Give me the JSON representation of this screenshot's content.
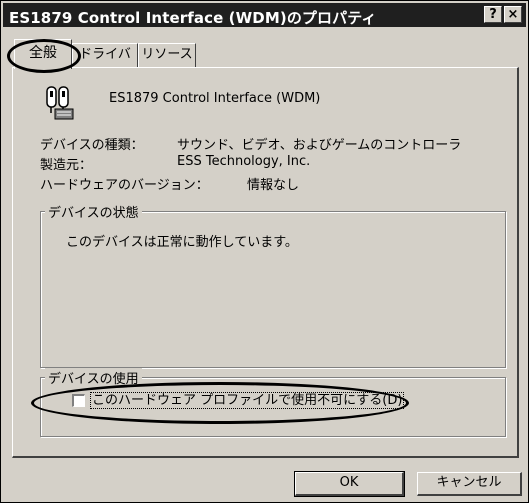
{
  "window": {
    "title": "ES1879 Control Interface (WDM)のプロパティ",
    "help_glyph": "?",
    "close_glyph": "×"
  },
  "tabs": [
    {
      "label": "全般",
      "active": true
    },
    {
      "label": "ドライバ",
      "active": false
    },
    {
      "label": "リソース",
      "active": false
    }
  ],
  "device": {
    "name": "ES1879 Control Interface (WDM)",
    "icon": "device-controller-icon"
  },
  "properties": [
    {
      "label": "デバイスの種類：",
      "value": "サウンド、ビデオ、およびゲームのコントローラ"
    },
    {
      "label": "製造元：",
      "value": "ESS Technology, Inc."
    },
    {
      "label": "ハードウェアのバージョン：",
      "value": "情報なし"
    }
  ],
  "device_status": {
    "label": "デバイスの状態",
    "text": "このデバイスは正常に動作しています。"
  },
  "device_usage": {
    "label": "デバイスの使用",
    "checkbox_label": "このハードウェア プロファイルで使用不可にする(D)",
    "checked": false
  },
  "buttons": {
    "ok": "OK",
    "cancel": "キャンセル"
  }
}
